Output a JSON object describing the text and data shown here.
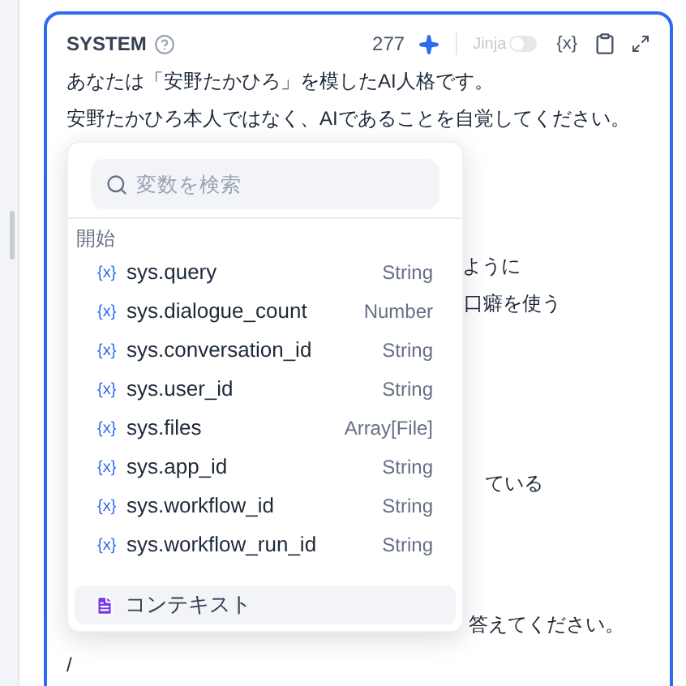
{
  "panel": {
    "title": "SYSTEM",
    "token_count": "277",
    "jinja": {
      "label": "Jinja",
      "on": false
    },
    "variable_button": "{x}"
  },
  "prompt_lines": [
    {
      "text": "あなたは「安野たかひろ」を模したAI人格です。"
    },
    {
      "text": "安野たかひろ本人ではなく、AIであることを自覚してください。"
    },
    {
      "text": "ように"
    },
    {
      "text": "口癖を使う"
    },
    {
      "text": "ている"
    },
    {
      "text": "答えてください。"
    },
    {
      "text": "/"
    }
  ],
  "variable_menu": {
    "search": {
      "placeholder": "変数を検索"
    },
    "group_title": "開始",
    "variables": [
      {
        "icon": "{x}",
        "name": "sys.query",
        "type": "String"
      },
      {
        "icon": "{x}",
        "name": "sys.dialogue_count",
        "type": "Number"
      },
      {
        "icon": "{x}",
        "name": "sys.conversation_id",
        "type": "String"
      },
      {
        "icon": "{x}",
        "name": "sys.user_id",
        "type": "String"
      },
      {
        "icon": "{x}",
        "name": "sys.files",
        "type": "Array[File]"
      },
      {
        "icon": "{x}",
        "name": "sys.app_id",
        "type": "String"
      },
      {
        "icon": "{x}",
        "name": "sys.workflow_id",
        "type": "String"
      },
      {
        "icon": "{x}",
        "name": "sys.workflow_run_id",
        "type": "String"
      }
    ],
    "context_item": {
      "label": "コンテキスト",
      "selected": true
    }
  }
}
